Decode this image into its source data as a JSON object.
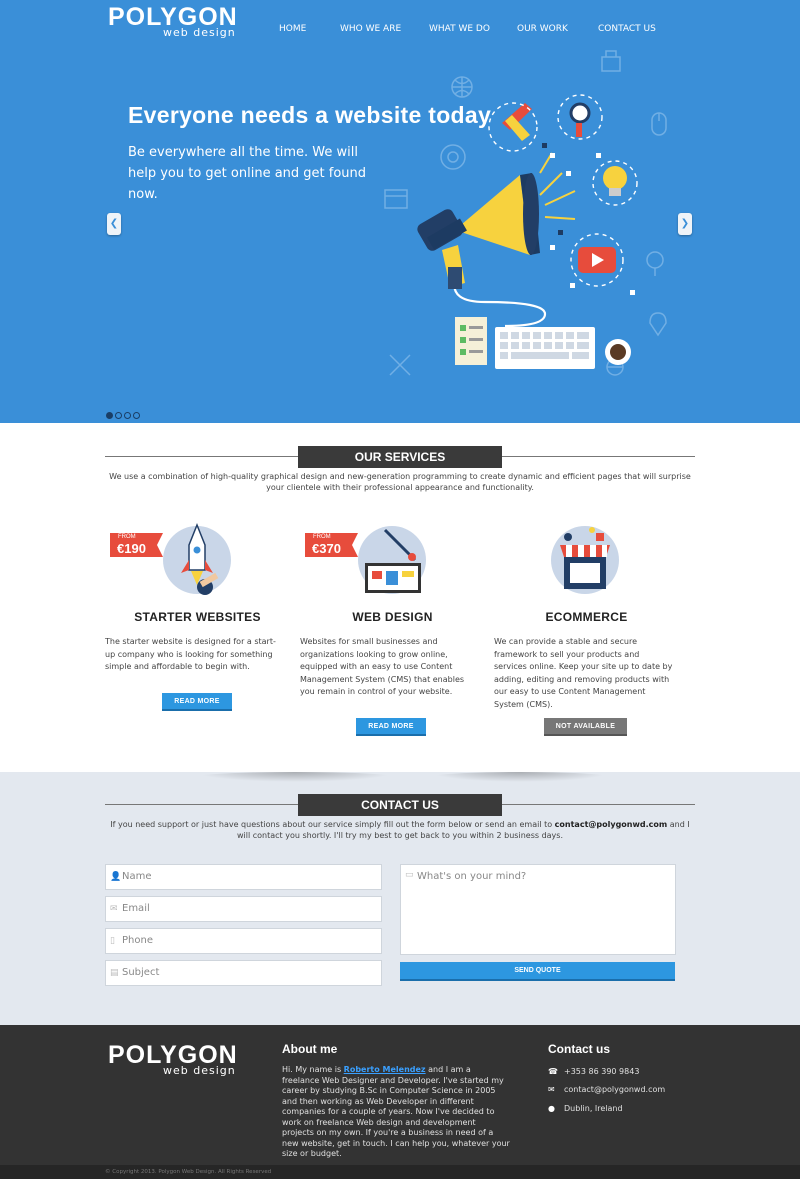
{
  "brand": {
    "name": "POLYGON",
    "tagline": "web design"
  },
  "nav": {
    "items": [
      "HOME",
      "WHO WE ARE",
      "WHAT WE DO",
      "OUR WORK",
      "CONTACT US"
    ]
  },
  "hero": {
    "title": "Everyone needs a website today",
    "subtitle": "Be everywhere all the time. We will help you to get online and get found now.",
    "prev_icon": "chevron-left-icon",
    "next_icon": "chevron-right-icon",
    "slides_total": 4,
    "slide_active": 1
  },
  "services": {
    "heading": "OUR SERVICES",
    "intro": "We use a combination of high-quality graphical design and new-generation programming to create dynamic and efficient pages that will surprise your clientele with their professional appearance and functionality.",
    "items": [
      {
        "from_label": "FROM",
        "price": "€190",
        "title": "STARTER WEBSITES",
        "text": "The starter website is designed for a start-up company who is looking for something simple and affordable to begin with.",
        "button": "READ MORE"
      },
      {
        "from_label": "FROM",
        "price": "€370",
        "title": "WEB DESIGN",
        "text": "Websites for small businesses and organizations looking to grow online, equipped with an easy to use Content Management System (CMS) that enables you remain in control of your website.",
        "button": "READ MORE"
      },
      {
        "title": "ECOMMERCE",
        "text": "We can provide a stable and secure framework to sell your products and services online. Keep your site up to date by adding, editing and removing products with our easy to use Content Management System (CMS).",
        "button": "NOT AVAILABLE"
      }
    ]
  },
  "contact": {
    "heading": "CONTACT US",
    "intro_before": "If you need support or just have questions about our service simply fill out the form below or send an email to ",
    "intro_email": "contact@polygonwd.com",
    "intro_after": " and I will contact you shortly. I'll try my best to get back to you within 2 business days.",
    "fields": {
      "name": "Name",
      "email": "Email",
      "phone": "Phone",
      "subject": "Subject",
      "message": "What's on your mind?"
    },
    "send_label": "SEND QUOTE"
  },
  "footer": {
    "about_heading": "About me",
    "about_before": "Hi. My name is ",
    "about_link": "Roberto Melendez",
    "about_after": " and I am a freelance Web Designer and Developer. I've started my career by studying B.Sc in Computer Science in 2005 and then working as Web Developer in different companies for a couple of years. Now I've decided to work on freelance Web design and development projects on my own. If you're a business in need of a new website, get in touch. I can help you, whatever your size or budget.",
    "contact_heading": "Contact us",
    "phone": "+353 86 390 9843",
    "email": "contact@polygonwd.com",
    "location": "Dublin, Ireland",
    "copyright": "© Copyright 2013. Polygon Web Design. All Rights Reserved"
  },
  "colors": {
    "hero_bg": "#3a8fd8",
    "accent": "#2d97e0",
    "dark": "#333333",
    "contact_bg": "#e3e8ef"
  }
}
